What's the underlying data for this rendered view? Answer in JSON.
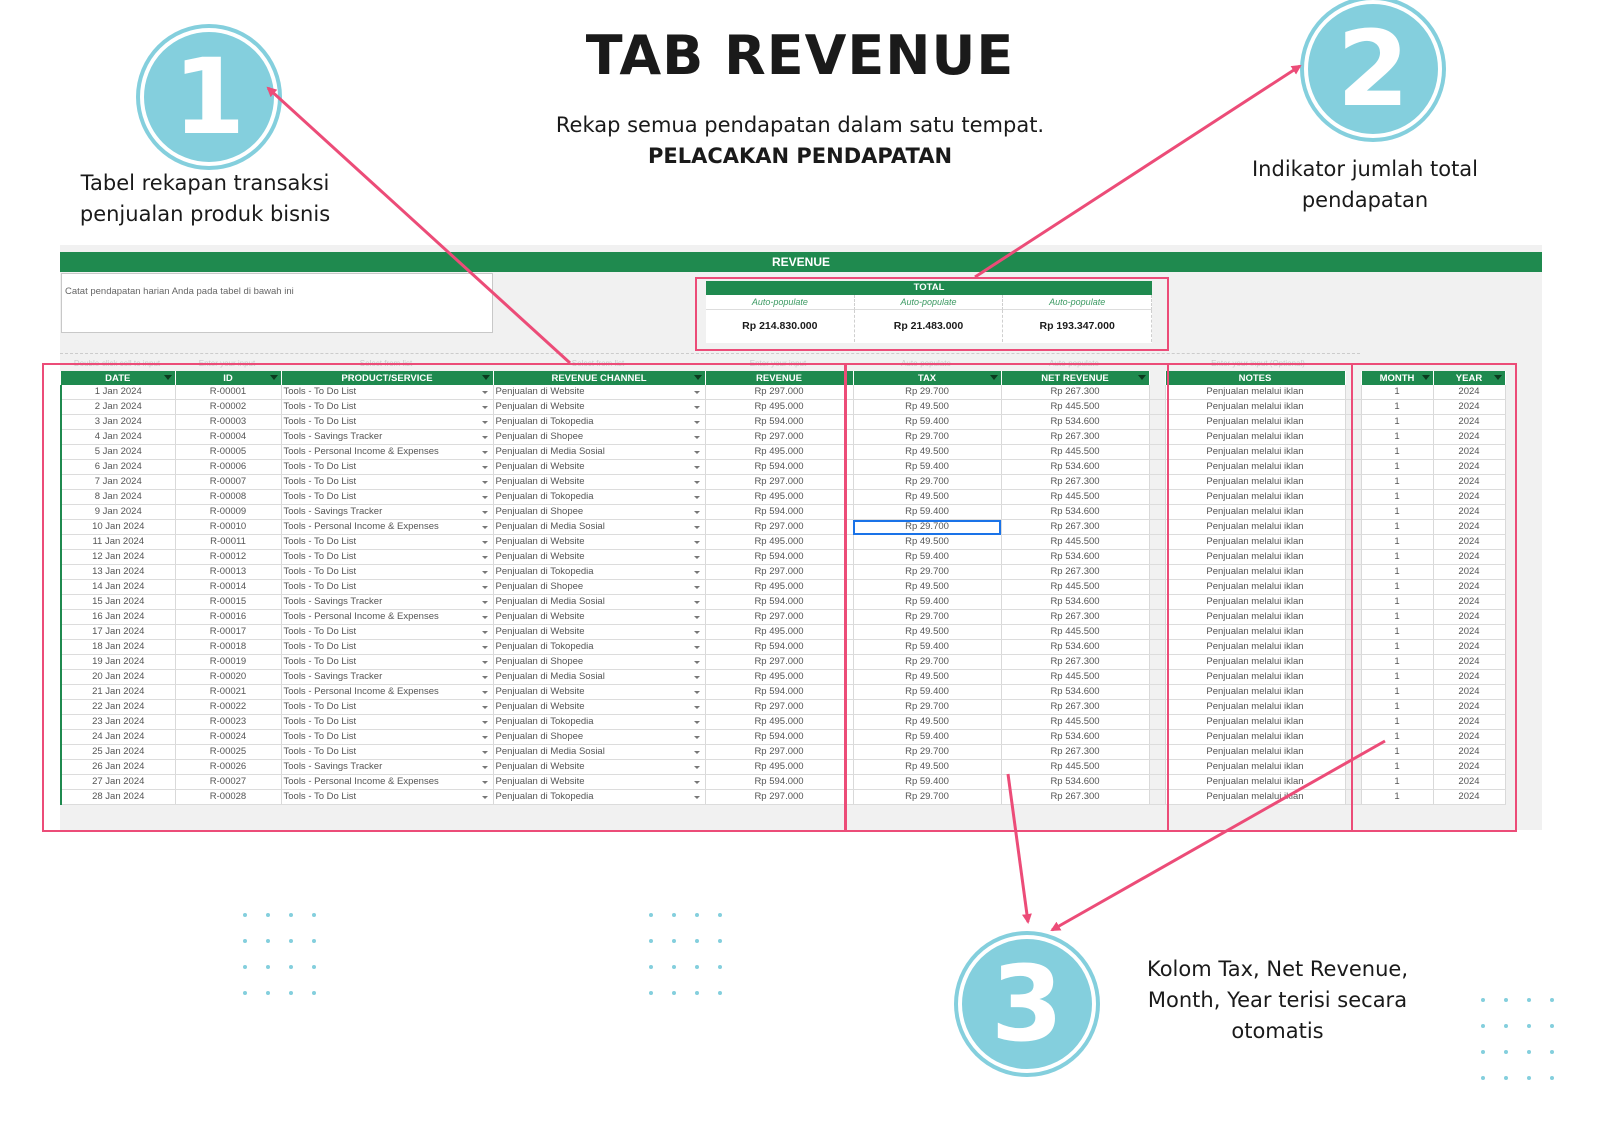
{
  "page": {
    "title": "TAB REVENUE",
    "subtitle": "Rekap semua pendapatan dalam satu tempat.",
    "subtitle_bold": "PELACAKAN PENDAPATAN"
  },
  "callouts": [
    {
      "number": "1",
      "text_line1": "Tabel rekapan transaksi",
      "text_line2": "penjualan produk bisnis"
    },
    {
      "number": "2",
      "text_line1": "Indikator jumlah total",
      "text_line2": "pendapatan"
    },
    {
      "number": "3",
      "text_line1": "Kolom Tax, Net Revenue,",
      "text_line2": "Month, Year terisi secara",
      "text_line3": "otomatis"
    }
  ],
  "colors": {
    "accent_green": "#1f8a4f",
    "highlight_pink": "#ec4c78",
    "badge_blue": "#84cfdd",
    "selection_blue": "#1a73e8"
  },
  "sheet": {
    "header": "REVENUE",
    "instruction": "Catat pendapatan harian Anda pada tabel di bawah ini",
    "total": {
      "label": "TOTAL",
      "auto": [
        "Auto-populate",
        "Auto-populate",
        "Auto-populate"
      ],
      "values": [
        "Rp 214.830.000",
        "Rp 21.483.000",
        "Rp 193.347.000"
      ]
    },
    "hints": [
      "Double-click cell to input",
      "Enter your input",
      "Select from list",
      "Select from list",
      "Enter your input",
      "Auto-populate",
      "Auto-populate",
      "Enter your input (Optional)"
    ],
    "columns": [
      "DATE",
      "ID",
      "PRODUCT/SERVICE",
      "REVENUE CHANNEL",
      "REVENUE",
      "TAX",
      "NET REVENUE",
      "NOTES",
      "MONTH",
      "YEAR"
    ],
    "rows": [
      [
        "1 Jan 2024",
        "R-00001",
        "Tools - To Do List",
        "Penjualan di Website",
        "Rp 297.000",
        "Rp 29.700",
        "Rp 267.300",
        "Penjualan melalui iklan",
        "1",
        "2024"
      ],
      [
        "2 Jan 2024",
        "R-00002",
        "Tools - To Do List",
        "Penjualan di Website",
        "Rp 495.000",
        "Rp 49.500",
        "Rp 445.500",
        "Penjualan melalui iklan",
        "1",
        "2024"
      ],
      [
        "3 Jan 2024",
        "R-00003",
        "Tools - To Do List",
        "Penjualan di Tokopedia",
        "Rp 594.000",
        "Rp 59.400",
        "Rp 534.600",
        "Penjualan melalui iklan",
        "1",
        "2024"
      ],
      [
        "4 Jan 2024",
        "R-00004",
        "Tools - Savings Tracker",
        "Penjualan di Shopee",
        "Rp 297.000",
        "Rp 29.700",
        "Rp 267.300",
        "Penjualan melalui iklan",
        "1",
        "2024"
      ],
      [
        "5 Jan 2024",
        "R-00005",
        "Tools - Personal Income & Expenses",
        "Penjualan di Media Sosial",
        "Rp 495.000",
        "Rp 49.500",
        "Rp 445.500",
        "Penjualan melalui iklan",
        "1",
        "2024"
      ],
      [
        "6 Jan 2024",
        "R-00006",
        "Tools - To Do List",
        "Penjualan di Website",
        "Rp 594.000",
        "Rp 59.400",
        "Rp 534.600",
        "Penjualan melalui iklan",
        "1",
        "2024"
      ],
      [
        "7 Jan 2024",
        "R-00007",
        "Tools - To Do List",
        "Penjualan di Website",
        "Rp 297.000",
        "Rp 29.700",
        "Rp 267.300",
        "Penjualan melalui iklan",
        "1",
        "2024"
      ],
      [
        "8 Jan 2024",
        "R-00008",
        "Tools - To Do List",
        "Penjualan di Tokopedia",
        "Rp 495.000",
        "Rp 49.500",
        "Rp 445.500",
        "Penjualan melalui iklan",
        "1",
        "2024"
      ],
      [
        "9 Jan 2024",
        "R-00009",
        "Tools - Savings Tracker",
        "Penjualan di Shopee",
        "Rp 594.000",
        "Rp 59.400",
        "Rp 534.600",
        "Penjualan melalui iklan",
        "1",
        "2024"
      ],
      [
        "10 Jan 2024",
        "R-00010",
        "Tools - Personal Income & Expenses",
        "Penjualan di Media Sosial",
        "Rp 297.000",
        "Rp 29.700",
        "Rp 267.300",
        "Penjualan melalui iklan",
        "1",
        "2024"
      ],
      [
        "11 Jan 2024",
        "R-00011",
        "Tools - To Do List",
        "Penjualan di Website",
        "Rp 495.000",
        "Rp 49.500",
        "Rp 445.500",
        "Penjualan melalui iklan",
        "1",
        "2024"
      ],
      [
        "12 Jan 2024",
        "R-00012",
        "Tools - To Do List",
        "Penjualan di Website",
        "Rp 594.000",
        "Rp 59.400",
        "Rp 534.600",
        "Penjualan melalui iklan",
        "1",
        "2024"
      ],
      [
        "13 Jan 2024",
        "R-00013",
        "Tools - To Do List",
        "Penjualan di Tokopedia",
        "Rp 297.000",
        "Rp 29.700",
        "Rp 267.300",
        "Penjualan melalui iklan",
        "1",
        "2024"
      ],
      [
        "14 Jan 2024",
        "R-00014",
        "Tools - To Do List",
        "Penjualan di Shopee",
        "Rp 495.000",
        "Rp 49.500",
        "Rp 445.500",
        "Penjualan melalui iklan",
        "1",
        "2024"
      ],
      [
        "15 Jan 2024",
        "R-00015",
        "Tools - Savings Tracker",
        "Penjualan di Media Sosial",
        "Rp 594.000",
        "Rp 59.400",
        "Rp 534.600",
        "Penjualan melalui iklan",
        "1",
        "2024"
      ],
      [
        "16 Jan 2024",
        "R-00016",
        "Tools - Personal Income & Expenses",
        "Penjualan di Website",
        "Rp 297.000",
        "Rp 29.700",
        "Rp 267.300",
        "Penjualan melalui iklan",
        "1",
        "2024"
      ],
      [
        "17 Jan 2024",
        "R-00017",
        "Tools - To Do List",
        "Penjualan di Website",
        "Rp 495.000",
        "Rp 49.500",
        "Rp 445.500",
        "Penjualan melalui iklan",
        "1",
        "2024"
      ],
      [
        "18 Jan 2024",
        "R-00018",
        "Tools - To Do List",
        "Penjualan di Tokopedia",
        "Rp 594.000",
        "Rp 59.400",
        "Rp 534.600",
        "Penjualan melalui iklan",
        "1",
        "2024"
      ],
      [
        "19 Jan 2024",
        "R-00019",
        "Tools - To Do List",
        "Penjualan di Shopee",
        "Rp 297.000",
        "Rp 29.700",
        "Rp 267.300",
        "Penjualan melalui iklan",
        "1",
        "2024"
      ],
      [
        "20 Jan 2024",
        "R-00020",
        "Tools - Savings Tracker",
        "Penjualan di Media Sosial",
        "Rp 495.000",
        "Rp 49.500",
        "Rp 445.500",
        "Penjualan melalui iklan",
        "1",
        "2024"
      ],
      [
        "21 Jan 2024",
        "R-00021",
        "Tools - Personal Income & Expenses",
        "Penjualan di Website",
        "Rp 594.000",
        "Rp 59.400",
        "Rp 534.600",
        "Penjualan melalui iklan",
        "1",
        "2024"
      ],
      [
        "22 Jan 2024",
        "R-00022",
        "Tools - To Do List",
        "Penjualan di Website",
        "Rp 297.000",
        "Rp 29.700",
        "Rp 267.300",
        "Penjualan melalui iklan",
        "1",
        "2024"
      ],
      [
        "23 Jan 2024",
        "R-00023",
        "Tools - To Do List",
        "Penjualan di Tokopedia",
        "Rp 495.000",
        "Rp 49.500",
        "Rp 445.500",
        "Penjualan melalui iklan",
        "1",
        "2024"
      ],
      [
        "24 Jan 2024",
        "R-00024",
        "Tools - To Do List",
        "Penjualan di Shopee",
        "Rp 594.000",
        "Rp 59.400",
        "Rp 534.600",
        "Penjualan melalui iklan",
        "1",
        "2024"
      ],
      [
        "25 Jan 2024",
        "R-00025",
        "Tools - To Do List",
        "Penjualan di Media Sosial",
        "Rp 297.000",
        "Rp 29.700",
        "Rp 267.300",
        "Penjualan melalui iklan",
        "1",
        "2024"
      ],
      [
        "26 Jan 2024",
        "R-00026",
        "Tools - Savings Tracker",
        "Penjualan di Website",
        "Rp 495.000",
        "Rp 49.500",
        "Rp 445.500",
        "Penjualan melalui iklan",
        "1",
        "2024"
      ],
      [
        "27 Jan 2024",
        "R-00027",
        "Tools - Personal Income & Expenses",
        "Penjualan di Website",
        "Rp 594.000",
        "Rp 59.400",
        "Rp 534.600",
        "Penjualan melalui iklan",
        "1",
        "2024"
      ],
      [
        "28 Jan 2024",
        "R-00028",
        "Tools - To Do List",
        "Penjualan di Tokopedia",
        "Rp 297.000",
        "Rp 29.700",
        "Rp 267.300",
        "Penjualan melalui iklan",
        "1",
        "2024"
      ]
    ],
    "selected_cell": {
      "row": 9,
      "column": "TAX"
    }
  }
}
